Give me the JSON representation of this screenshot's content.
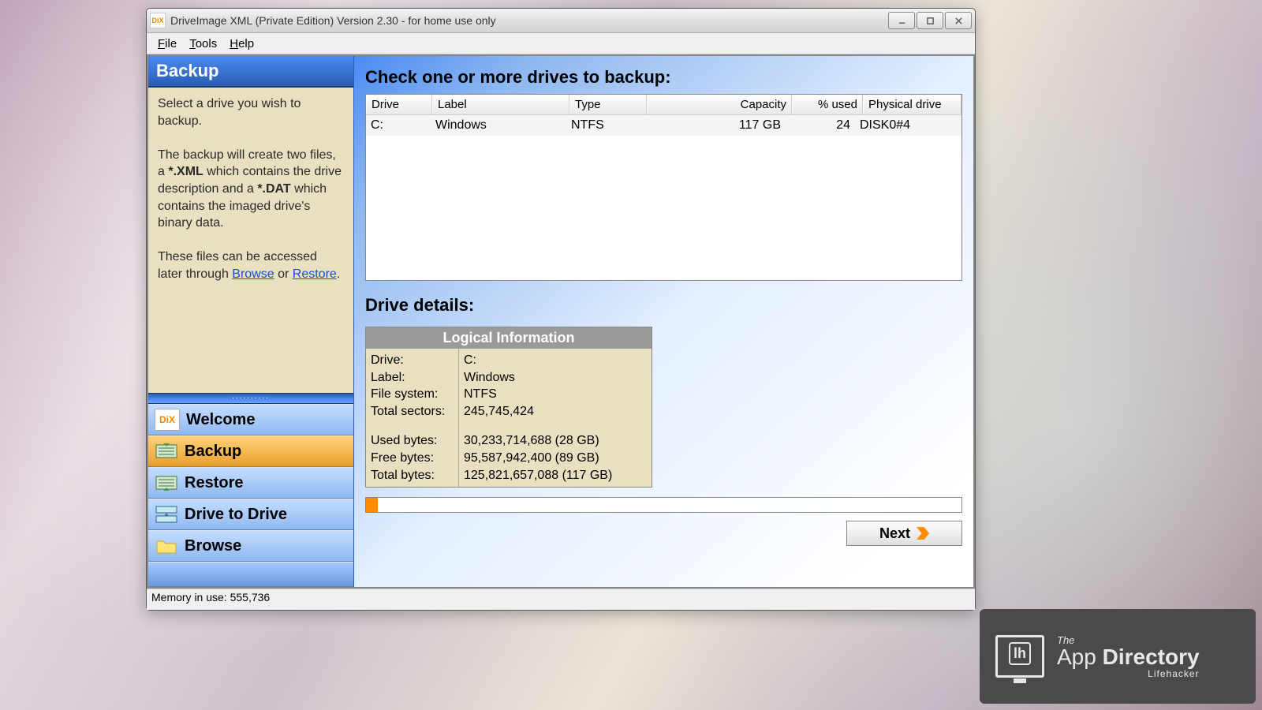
{
  "window": {
    "title": "DriveImage XML (Private Edition) Version 2.30 - for home use only",
    "icon_text": "DiX"
  },
  "menu": {
    "file": "File",
    "tools": "Tools",
    "help": "Help"
  },
  "sidebar": {
    "header": "Backup",
    "desc1": "Select a drive you wish to backup.",
    "desc2a": "The backup will create two files, a ",
    "desc2b": "*.XML",
    "desc2c": " which contains the drive description and a ",
    "desc2d": "*.DAT",
    "desc2e": " which contains the imaged drive's binary data.",
    "desc3a": "These files can be accessed later through ",
    "link_browse": "Browse",
    "desc3b": " or ",
    "link_restore": "Restore",
    "desc3c": "."
  },
  "nav": {
    "welcome": "Welcome",
    "backup": "Backup",
    "restore": "Restore",
    "d2d": "Drive to Drive",
    "browse": "Browse"
  },
  "main": {
    "heading": "Check one or more drives to backup:",
    "columns": {
      "drive": "Drive",
      "label": "Label",
      "type": "Type",
      "capacity": "Capacity",
      "used": "% used",
      "physical": "Physical drive"
    },
    "row": {
      "drive": "C:",
      "label": "Windows",
      "type": "NTFS",
      "capacity": "117 GB",
      "used": "24",
      "physical": "DISK0#4"
    },
    "details_heading": "Drive details:",
    "details_title": "Logical Information",
    "labels": {
      "drive": "Drive:",
      "label": "Label:",
      "fs": "File system:",
      "sectors": "Total sectors:",
      "used": "Used bytes:",
      "free": "Free bytes:",
      "total": "Total bytes:"
    },
    "values": {
      "drive": "C:",
      "label": "Windows",
      "fs": "NTFS",
      "sectors": "245,745,424",
      "used": "30,233,714,688 (28 GB)",
      "free": "95,587,942,400 (89 GB)",
      "total": "125,821,657,088 (117 GB)"
    },
    "next": "Next"
  },
  "status": "Memory in use: 555,736",
  "watermark": {
    "the": "The",
    "app": "App",
    "dir": "Directory",
    "sub": "Lifehacker"
  }
}
